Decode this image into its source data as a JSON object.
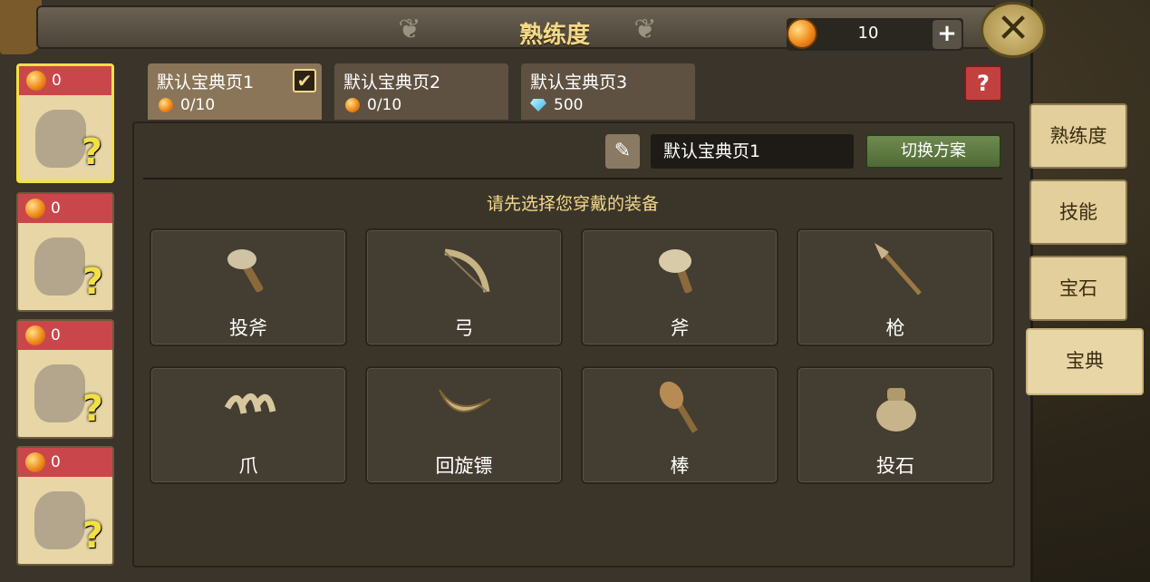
{
  "header": {
    "title": "熟练度",
    "coin_amount": "10",
    "plus_label": "+",
    "close_label": "✕"
  },
  "cards": [
    {
      "cost": "0",
      "selected": true
    },
    {
      "cost": "0",
      "selected": false
    },
    {
      "cost": "0",
      "selected": false
    },
    {
      "cost": "0",
      "selected": false
    }
  ],
  "card_question_mark": "?",
  "tabs": [
    {
      "name": "默认宝典页1",
      "sub": "0/10",
      "sub_icon": "coin-icon",
      "active": true
    },
    {
      "name": "默认宝典页2",
      "sub": "0/10",
      "sub_icon": "coin-icon",
      "active": false
    },
    {
      "name": "默认宝典页3",
      "sub": "500",
      "sub_icon": "diamond-icon",
      "active": false
    }
  ],
  "tab_check": "✔",
  "help_label": "?",
  "plan": {
    "name": "默认宝典页1",
    "switch_label": "切换方案",
    "edit_icon": "✎"
  },
  "hint": "请先选择您穿戴的装备",
  "weapons": [
    {
      "label": "投斧"
    },
    {
      "label": "弓"
    },
    {
      "label": "斧"
    },
    {
      "label": "枪"
    },
    {
      "label": "爪"
    },
    {
      "label": "回旋镖"
    },
    {
      "label": "棒"
    },
    {
      "label": "投石"
    }
  ],
  "side_tabs": [
    {
      "label": "熟练度"
    },
    {
      "label": "技能"
    },
    {
      "label": "宝石"
    },
    {
      "label": "宝典"
    }
  ],
  "colors": {
    "accent_gold": "#f3d98a",
    "cost_red": "#c9474b",
    "switch_green": "#5f7a42"
  }
}
